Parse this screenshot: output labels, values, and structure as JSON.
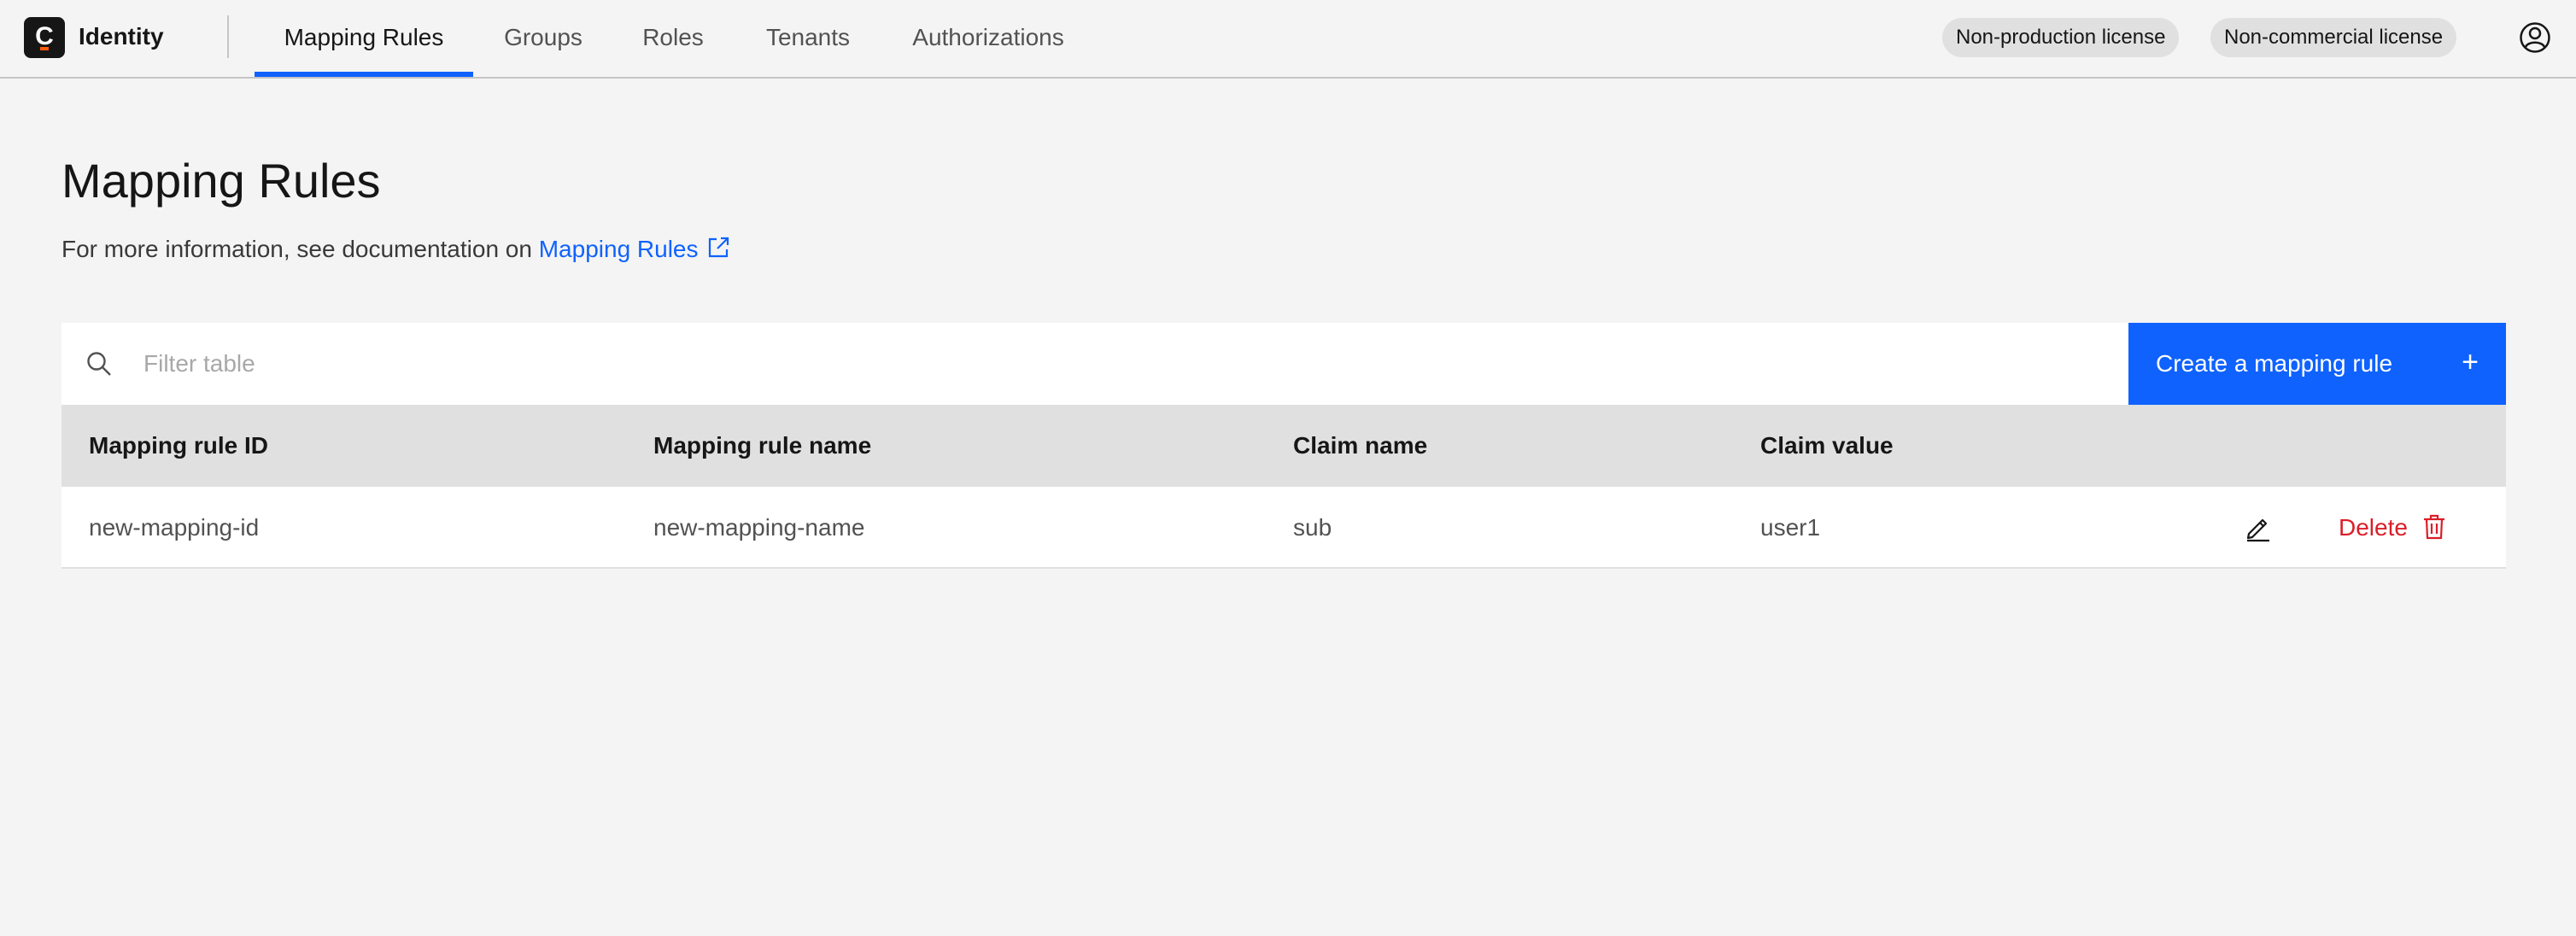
{
  "app": {
    "logo_letter": "C",
    "name": "Identity"
  },
  "nav": {
    "tabs": [
      {
        "label": "Mapping Rules",
        "active": true
      },
      {
        "label": "Groups",
        "active": false
      },
      {
        "label": "Roles",
        "active": false
      },
      {
        "label": "Tenants",
        "active": false
      },
      {
        "label": "Authorizations",
        "active": false
      }
    ]
  },
  "licenses": [
    {
      "label": "Non-production license"
    },
    {
      "label": "Non-commercial license"
    }
  ],
  "header_icons": {
    "user": "user-avatar-icon"
  },
  "page": {
    "title": "Mapping Rules",
    "info_prefix": "For more information, see documentation on ",
    "info_link": "Mapping Rules",
    "info_link_icon": "external-link-icon"
  },
  "toolbar": {
    "search_icon": "search-icon",
    "filter_placeholder": "Filter table",
    "filter_value": "",
    "create_label": "Create a mapping rule",
    "create_icon": "+"
  },
  "table": {
    "columns": [
      "Mapping rule ID",
      "Mapping rule name",
      "Claim name",
      "Claim value"
    ],
    "rows": [
      {
        "cells": [
          "new-mapping-id",
          "new-mapping-name",
          "sub",
          "user1"
        ],
        "edit_icon": "edit-icon",
        "delete_label": "Delete",
        "delete_icon": "trash-icon"
      }
    ]
  },
  "colors": {
    "accent": "#0f62fe",
    "danger": "#da1e28",
    "background": "#f4f4f4",
    "logo_bg": "#161616",
    "logo_accent": "#fc5d0d"
  }
}
